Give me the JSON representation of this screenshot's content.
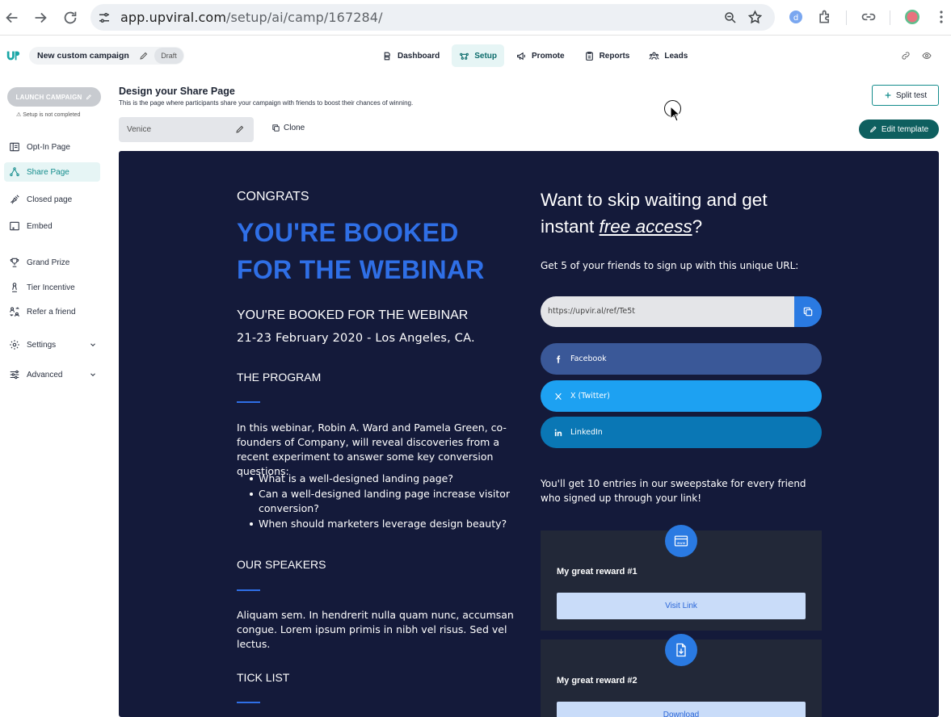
{
  "browser": {
    "url_host": "app.upviral.com",
    "url_path": "/setup/ai/camp/167284/"
  },
  "header": {
    "campaign_name": "New custom campaign",
    "status": "Draft",
    "nav": [
      {
        "label": "Dashboard",
        "icon": "dashboard-icon"
      },
      {
        "label": "Setup",
        "icon": "setup-icon",
        "active": true
      },
      {
        "label": "Promote",
        "icon": "megaphone-icon"
      },
      {
        "label": "Reports",
        "icon": "clipboard-icon"
      },
      {
        "label": "Leads",
        "icon": "users-icon"
      }
    ]
  },
  "sidebar": {
    "launch_label": "LAUNCH CAMPAIGN",
    "setup_note": "Setup is not completed",
    "items": [
      {
        "label": "Opt-In Page",
        "icon": "optin-icon"
      },
      {
        "label": "Share Page",
        "icon": "share-icon",
        "active": true
      },
      {
        "label": "Closed page",
        "icon": "closed-icon"
      },
      {
        "label": "Embed",
        "icon": "embed-icon"
      },
      {
        "label": "Grand Prize",
        "icon": "trophy-icon"
      },
      {
        "label": "Tier Incentive",
        "icon": "tier-icon"
      },
      {
        "label": "Refer a friend",
        "icon": "refer-icon"
      },
      {
        "label": "Settings",
        "icon": "settings-icon"
      },
      {
        "label": "Advanced",
        "icon": "advanced-icon"
      }
    ]
  },
  "main": {
    "title": "Design your Share Page",
    "subtitle": "This is the page where participants share your campaign with friends to boost their chances of winning.",
    "split_test_label": "Split test",
    "variant_name": "Venice",
    "clone_label": "Clone",
    "edit_template_label": "Edit template"
  },
  "preview": {
    "congrats": "CONGRATS",
    "headline_line1": "YOU'RE BOOKED",
    "headline_line2": "FOR THE WEBINAR",
    "subheading": "YOU'RE BOOKED FOR THE WEBINAR",
    "date": "21-23 February 2020 - Los Angeles, CA.",
    "program_title": "THE PROGRAM",
    "program_text": "In this webinar, Robin A. Ward and Pamela Green, co-founders of Company, will reveal discoveries from a recent experiment to answer some key conversion questions:",
    "program_bullets": [
      "What is a well-designed landing page?",
      "Can a well-designed landing page increase visitor conversion?",
      "When should marketers leverage design beauty?"
    ],
    "speakers_title": "OUR SPEAKERS",
    "speakers_text": "Aliquam sem. In hendrerit nulla quam nunc, accumsan congue. Lorem ipsum primis in nibh vel risus. Sed vel lectus.",
    "ticklist_title": "TICK LIST",
    "skip_line1": "Want to skip waiting and get",
    "skip_pre": "instant ",
    "skip_em": "free access",
    "skip_post": "?",
    "get_five": "Get 5 of your friends to sign up with this unique URL:",
    "ref_url": "https://upvir.al/ref/Te5t",
    "facebook_label": "Facebook",
    "twitter_label": "X (Twitter)",
    "linkedin_label": "LinkedIn",
    "entries_text": "You'll get 10 entries in our sweepstake for every friend who signed up through your link!",
    "rewards": [
      {
        "title": "My great reward #1",
        "button": "Visit Link",
        "icon": "www-icon"
      },
      {
        "title": "My great reward #2",
        "button": "Download",
        "icon": "download-file-icon"
      }
    ]
  },
  "colors": {
    "brand_teal": "#138c8c",
    "preview_bg": "#141a3a",
    "accent_blue": "#2f6fe6"
  }
}
